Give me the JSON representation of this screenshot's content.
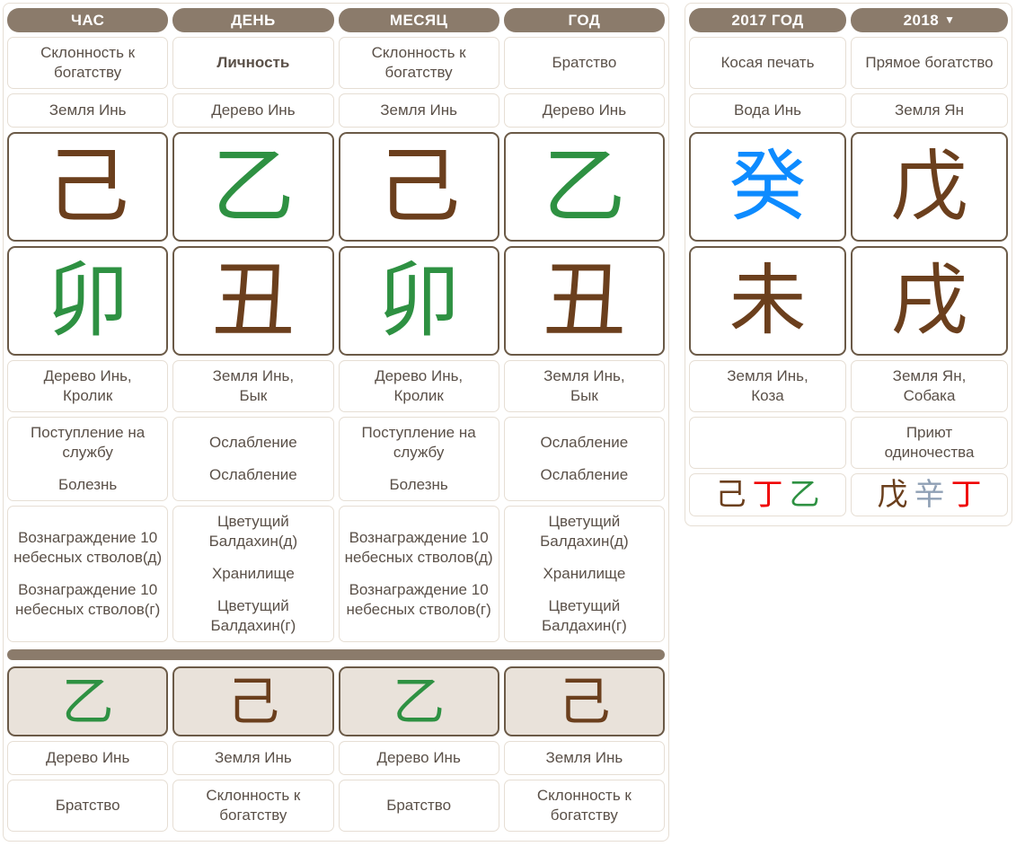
{
  "colors": {
    "header_bg": "#8b7b6b",
    "wood": "#2e9142",
    "earth": "#6b3f1d",
    "water": "#0d8bff",
    "fire": "#ef0000",
    "metal": "#8fa0b5",
    "text": "#5a5048",
    "cell_border": "#e6ded4",
    "char_border": "#6b5a47",
    "luck_bg": "#e9e2da"
  },
  "natal_chart": {
    "headers": [
      "ЧАС",
      "ДЕНЬ",
      "МЕСЯЦ",
      "ГОД"
    ],
    "ten_gods_stem": [
      "Склонность к богатству",
      "Личность",
      "Склонность к богатству",
      "Братство"
    ],
    "ten_gods_stem_bold": [
      false,
      true,
      false,
      false
    ],
    "stem_elements": [
      "Земля Инь",
      "Дерево Инь",
      "Земля Инь",
      "Дерево Инь"
    ],
    "heavenly_stems": [
      {
        "char": "己",
        "element": "earth"
      },
      {
        "char": "乙",
        "element": "wood"
      },
      {
        "char": "己",
        "element": "earth"
      },
      {
        "char": "乙",
        "element": "wood"
      }
    ],
    "earthly_branches": [
      {
        "char": "卯",
        "element": "wood"
      },
      {
        "char": "丑",
        "element": "earth"
      },
      {
        "char": "卯",
        "element": "wood"
      },
      {
        "char": "丑",
        "element": "earth"
      }
    ],
    "branch_elements": [
      [
        "Дерево Инь,",
        "Кролик"
      ],
      [
        "Земля Инь,",
        "Бык"
      ],
      [
        "Дерево Инь,",
        "Кролик"
      ],
      [
        "Земля Инь,",
        "Бык"
      ]
    ],
    "life_stages": [
      [
        "Поступление на службу",
        "Болезнь"
      ],
      [
        "Ослабление",
        "Ослабление"
      ],
      [
        "Поступление на службу",
        "Болезнь"
      ],
      [
        "Ослабление",
        "Ослабление"
      ]
    ],
    "special_stars": [
      [
        "Вознаграждение 10 небесных стволов(д)",
        "Вознаграждение 10 небесных стволов(г)"
      ],
      [
        "Цветущий Балдахин(д)",
        "Хранилище",
        "Цветущий Балдахин(г)"
      ],
      [
        "Вознаграждение 10 небесных стволов(д)",
        "Вознаграждение 10 небесных стволов(г)"
      ],
      [
        "Цветущий Балдахин(д)",
        "Хранилище",
        "Цветущий Балдахин(г)"
      ]
    ]
  },
  "luck_pillars": {
    "chars": [
      {
        "char": "乙",
        "element": "wood"
      },
      {
        "char": "己",
        "element": "earth"
      },
      {
        "char": "乙",
        "element": "wood"
      },
      {
        "char": "己",
        "element": "earth"
      }
    ],
    "elements": [
      "Дерево Инь",
      "Земля Инь",
      "Дерево Инь",
      "Земля Инь"
    ],
    "ten_gods": [
      "Братство",
      "Склонность к богатству",
      "Братство",
      "Склонность к богатству"
    ]
  },
  "annual_pillars": {
    "headers": [
      {
        "label": "2017 ГОД",
        "has_caret": false
      },
      {
        "label": "2018",
        "has_caret": true,
        "caret": "▼"
      }
    ],
    "ten_gods_stem": [
      "Косая печать",
      "Прямое богатство"
    ],
    "stem_elements": [
      "Вода Инь",
      "Земля Ян"
    ],
    "heavenly_stems": [
      {
        "char": "癸",
        "element": "water"
      },
      {
        "char": "戊",
        "element": "earth"
      }
    ],
    "earthly_branches": [
      {
        "char": "未",
        "element": "earth"
      },
      {
        "char": "戌",
        "element": "earth"
      }
    ],
    "branch_elements": [
      [
        "Земля Инь,",
        "Коза"
      ],
      [
        "Земля Ян,",
        "Собака"
      ]
    ],
    "special_stars": [
      [
        ""
      ],
      [
        "Приют",
        "одиночества"
      ]
    ],
    "hidden_stems": [
      [
        {
          "char": "己",
          "element": "earth"
        },
        {
          "char": "丁",
          "element": "fire"
        },
        {
          "char": "乙",
          "element": "wood"
        }
      ],
      [
        {
          "char": "戊",
          "element": "earth"
        },
        {
          "char": "辛",
          "element": "metal"
        },
        {
          "char": "丁",
          "element": "fire"
        }
      ]
    ]
  }
}
